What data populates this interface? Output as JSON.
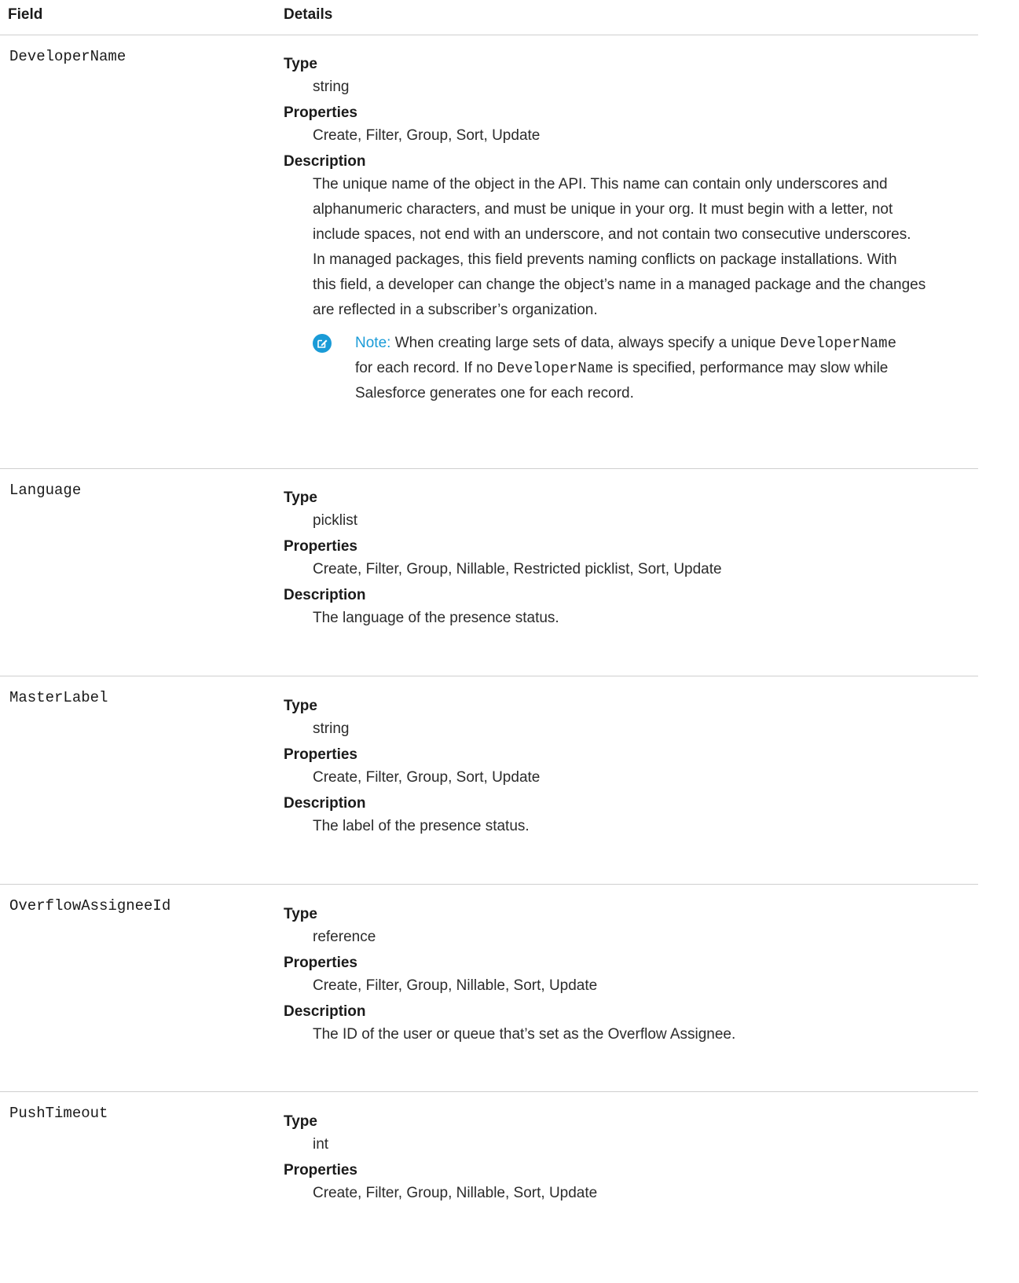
{
  "header": {
    "field": "Field",
    "details": "Details"
  },
  "labels": {
    "type": "Type",
    "properties": "Properties",
    "description": "Description"
  },
  "rows": [
    {
      "field": "DeveloperName",
      "type": "string",
      "properties": "Create, Filter, Group, Sort, Update",
      "description_lines": [
        "The unique name of the object in the API. This name can contain only underscores and",
        "alphanumeric characters, and must be unique in your org. It must begin with a letter, not",
        "include spaces, not end with an underscore, and not contain two consecutive underscores.",
        "In managed packages, this field prevents naming conflicts on package installations. With",
        "this field, a developer can change the object’s name in a managed package and the changes",
        "are reflected in a subscriber’s organization."
      ],
      "note": {
        "label": "Note:",
        "part1": "When creating large sets of data, always specify a unique",
        "code1": "DeveloperName",
        "part2": "for each record. If no",
        "code2": "DeveloperName",
        "part3": "is specified, performance may slow while",
        "part4": "Salesforce generates one for each record."
      }
    },
    {
      "field": "Language",
      "type": "picklist",
      "properties": "Create, Filter, Group, Nillable, Restricted picklist, Sort, Update",
      "description_lines": [
        "The language of the presence status."
      ]
    },
    {
      "field": "MasterLabel",
      "type": "string",
      "properties": "Create, Filter, Group, Sort, Update",
      "description_lines": [
        "The label of the presence status."
      ]
    },
    {
      "field": "OverflowAssigneeId",
      "type": "reference",
      "properties": "Create, Filter, Group, Nillable, Sort, Update",
      "description_lines": [
        "The ID of the user or queue that’s set as the Overflow Assignee."
      ]
    },
    {
      "field": "PushTimeout",
      "type": "int",
      "properties": "Create, Filter, Group, Nillable, Sort, Update"
    }
  ],
  "icons": {
    "note": "edit-pencil-icon"
  },
  "colors": {
    "note_accent": "#1a9bd7",
    "divider": "#cfcfcf"
  }
}
